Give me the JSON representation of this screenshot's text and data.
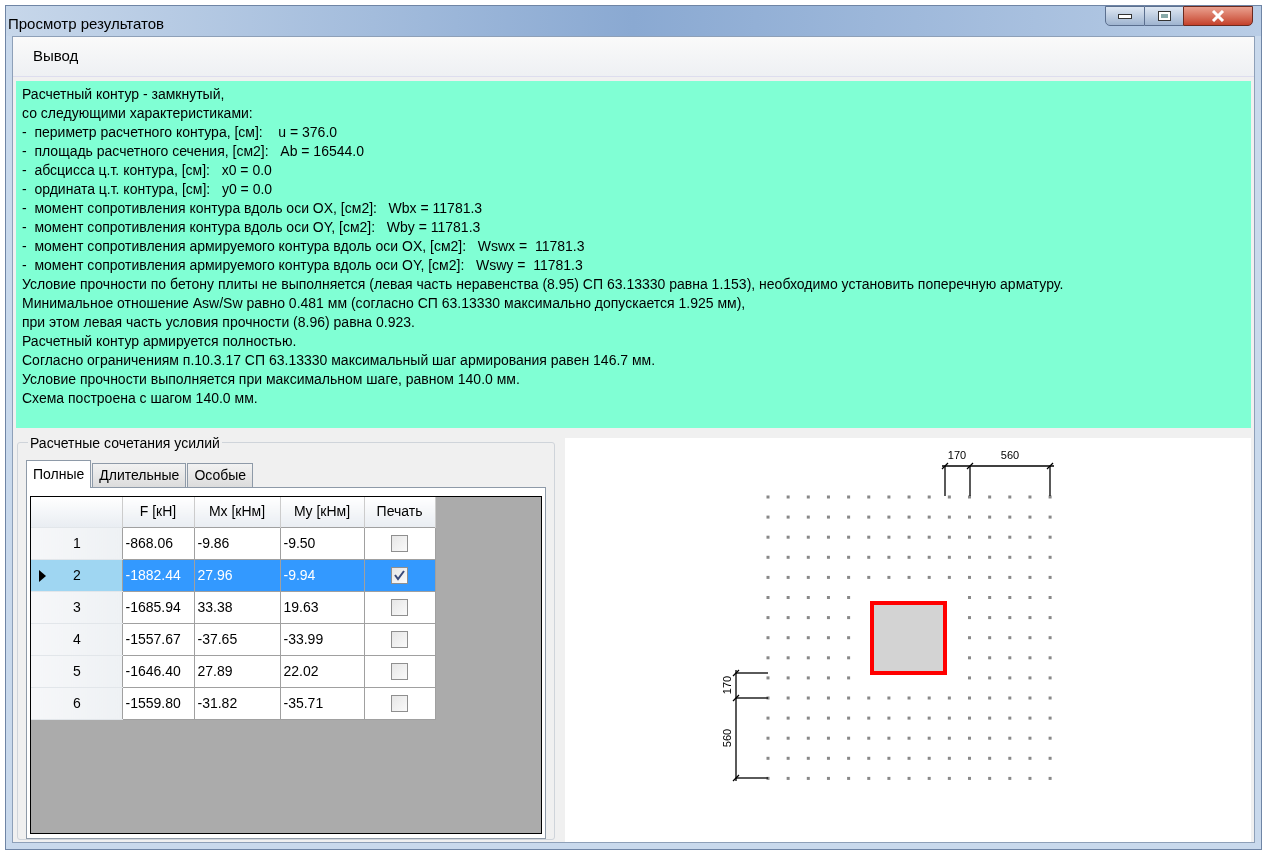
{
  "window": {
    "title": "Просмотр результатов"
  },
  "menu": [
    {
      "label": "Вывод"
    }
  ],
  "results_text": [
    "Расчетный контур - замкнутый,",
    "со следующими характеристиками:",
    "-  периметр расчетного контура, [см]:    u = 376.0",
    "-  площадь расчетного сечения, [см2]:   Ab = 16544.0",
    "-  абсцисса ц.т. контура, [см]:   x0 = 0.0",
    "-  ордината ц.т. контура, [см]:   y0 = 0.0",
    "-  момент сопротивления контура вдоль оси OX, [см2]:   Wbx = 11781.3",
    "-  момент сопротивления контура вдоль оси OY, [см2]:   Wby = 11781.3",
    "-  момент сопротивления армируемого контура вдоль оси OX, [см2]:   Wswx =  11781.3",
    "-  момент сопротивления армируемого контура вдоль оси OY, [см2]:   Wswy =  11781.3",
    "Условие прочности по бетону плиты не выполняется (левая часть неравенства (8.95) СП 63.13330 равна 1.153), необходимо установить поперечную арматуру.",
    "Минимальное отношение Asw/Sw равно 0.481 мм (согласно СП 63.13330 максимально допускается 1.925 мм),",
    "при этом левая часть условия прочности (8.96) равна 0.923.",
    "Расчетный контур армируется полностью.",
    "Согласно ограничениям п.10.3.17 СП 63.13330 максимальный шаг армирования равен 146.7 мм.",
    "Условие прочности выполняется при максимальном шаге, равном 140.0 мм.",
    "Схема построена с шагом 140.0 мм."
  ],
  "forces_group": {
    "title": "Расчетные сочетания усилий",
    "tabs": [
      {
        "label": "Полные",
        "selected": true
      },
      {
        "label": "Длительные",
        "selected": false
      },
      {
        "label": "Особые",
        "selected": false
      }
    ],
    "table": {
      "columns": [
        "F [кН]",
        "Mx [кНм]",
        "My [кНм]",
        "Печать"
      ],
      "rows": [
        {
          "number": "1",
          "cells": [
            "-868.06",
            "-9.86",
            "-9.50"
          ],
          "print": false,
          "selected": false
        },
        {
          "number": "2",
          "cells": [
            "-1882.44",
            "27.96",
            "-9.94"
          ],
          "print": true,
          "selected": true
        },
        {
          "number": "3",
          "cells": [
            "-1685.94",
            "33.38",
            "19.63"
          ],
          "print": false,
          "selected": false
        },
        {
          "number": "4",
          "cells": [
            "-1557.67",
            "-37.65",
            "-33.99"
          ],
          "print": false,
          "selected": false
        },
        {
          "number": "5",
          "cells": [
            "-1646.40",
            "27.89",
            "22.02"
          ],
          "print": false,
          "selected": false
        },
        {
          "number": "6",
          "cells": [
            "-1559.80",
            "-31.82",
            "-35.71"
          ],
          "print": false,
          "selected": false
        }
      ]
    }
  },
  "scheme": {
    "top_dimensions": [
      "170",
      "560"
    ],
    "left_dimensions": [
      "170",
      "560"
    ]
  }
}
